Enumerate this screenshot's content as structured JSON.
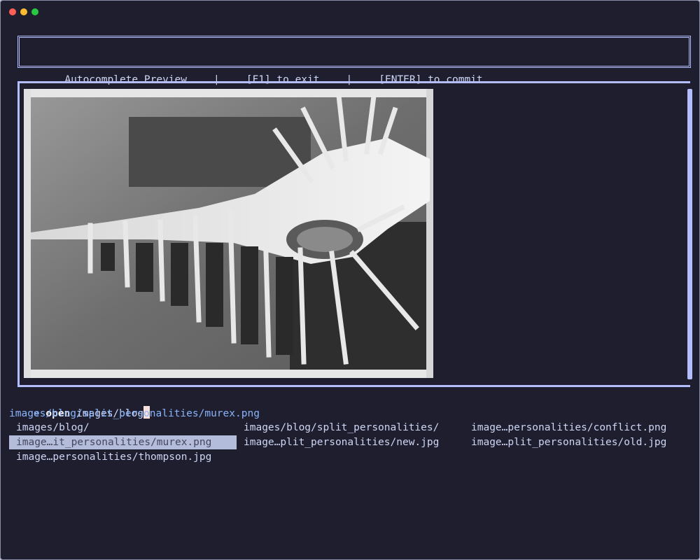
{
  "window": {
    "traffic_lights": [
      "close",
      "minimize",
      "zoom"
    ],
    "colors": {
      "background": "#1e1e2e",
      "border": "#b4befe",
      "hint": "#89b4fa",
      "selection": "#b4bcdc",
      "cursor": "#f5e0dc"
    }
  },
  "header": {
    "title": "Autocomplete Preview",
    "sep1": "|",
    "exit_hint": "[F1] to exit",
    "sep2": "|",
    "commit_hint": "[ENTER] to commit"
  },
  "preview": {
    "image_description_icon": "murex-shell-image"
  },
  "prompt": {
    "symbol": "»",
    "command": "open",
    "argument": "images/blog"
  },
  "hint": {
    "text": "images/blog/split_personalities/murex.png"
  },
  "completions": [
    {
      "label": "images/blog/",
      "selected": false
    },
    {
      "label": "images/blog/split_personalities/",
      "selected": false
    },
    {
      "label": "image…personalities/conflict.png",
      "selected": false
    },
    {
      "label": "image…it_personalities/murex.png",
      "selected": true
    },
    {
      "label": "image…plit_personalities/new.jpg",
      "selected": false
    },
    {
      "label": "image…plit_personalities/old.jpg",
      "selected": false
    },
    {
      "label": "image…personalities/thompson.jpg",
      "selected": false
    }
  ]
}
